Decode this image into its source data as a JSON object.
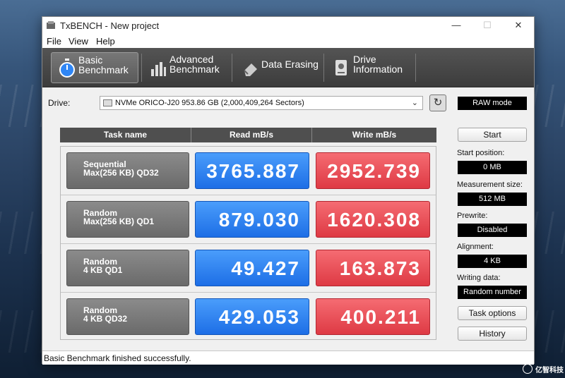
{
  "window": {
    "title": "TxBENCH - New project",
    "controls": {
      "minimize": "—",
      "maximize": "☐",
      "close": "✕"
    }
  },
  "menu": [
    "File",
    "View",
    "Help"
  ],
  "tabs": [
    {
      "label": "Basic\nBenchmark",
      "icon": "stopwatch-icon",
      "active": true
    },
    {
      "label": "Advanced\nBenchmark",
      "icon": "bar-chart-icon",
      "active": false
    },
    {
      "label": "Data Erasing",
      "icon": "eraser-icon",
      "active": false
    },
    {
      "label": "Drive\nInformation",
      "icon": "drive-info-icon",
      "active": false
    }
  ],
  "drive": {
    "label": "Drive:",
    "selected": "NVMe ORICO-J20  953.86 GB (2,000,409,264 Sectors)"
  },
  "raw_mode": "RAW mode",
  "table": {
    "headers": [
      "Task name",
      "Read mB/s",
      "Write mB/s"
    ],
    "rows": [
      {
        "task_line1": "Sequential",
        "task_line2": "Max(256 KB) QD32",
        "read": "3765.887",
        "write": "2952.739"
      },
      {
        "task_line1": "Random",
        "task_line2": "Max(256 KB) QD1",
        "read": "879.030",
        "write": "1620.308"
      },
      {
        "task_line1": "Random",
        "task_line2": "4 KB QD1",
        "read": "49.427",
        "write": "163.873"
      },
      {
        "task_line1": "Random",
        "task_line2": "4 KB QD32",
        "read": "429.053",
        "write": "400.211"
      }
    ]
  },
  "sidebar": {
    "start_button": "Start",
    "start_position_label": "Start position:",
    "start_position": "0 MB",
    "measurement_size_label": "Measurement size:",
    "measurement_size": "512 MB",
    "prewrite_label": "Prewrite:",
    "prewrite": "Disabled",
    "alignment_label": "Alignment:",
    "alignment": "4 KB",
    "writing_data_label": "Writing data:",
    "writing_data": "Random number",
    "task_options_button": "Task options",
    "history_button": "History"
  },
  "status": "Basic Benchmark finished successfully.",
  "watermark": "亿智科技",
  "colors": {
    "read": "#2f86f5",
    "write": "#e84c55",
    "tabbar": "#464646"
  }
}
